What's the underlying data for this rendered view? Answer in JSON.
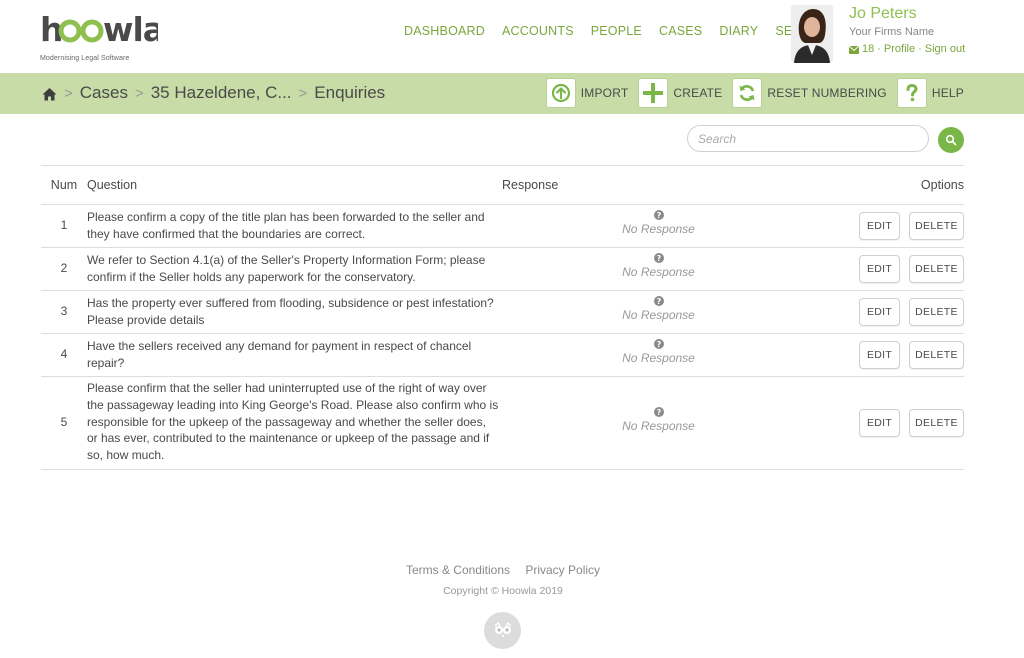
{
  "brand": {
    "name": "hoowla",
    "tagline": "Modernising Legal Software",
    "color": "#8fbf4e"
  },
  "nav": [
    "DASHBOARD",
    "ACCOUNTS",
    "PEOPLE",
    "CASES",
    "DIARY",
    "SETUP"
  ],
  "user": {
    "name": "Jo Peters",
    "firm": "Your Firms Name",
    "message_count": "18",
    "profile_label": "Profile",
    "sign_out_label": "Sign out",
    "separator": "·"
  },
  "breadcrumb": {
    "items": [
      "Cases",
      "35 Hazeldene, C...",
      "Enquiries"
    ],
    "separator": ">"
  },
  "actions": {
    "import": "IMPORT",
    "create": "CREATE",
    "reset": "RESET NUMBERING",
    "help": "HELP"
  },
  "search": {
    "placeholder": "Search"
  },
  "table": {
    "headers": {
      "num": "Num",
      "question": "Question",
      "response": "Response",
      "options": "Options"
    },
    "edit_label": "EDIT",
    "delete_label": "DELETE",
    "rows": [
      {
        "num": "1",
        "question": "Please confirm a copy of the title plan has been forwarded to the seller and they have confirmed that the boundaries are correct.",
        "response": "No Response"
      },
      {
        "num": "2",
        "question": "We refer to Section 4.1(a) of the Seller's Property Information Form; please confirm if the Seller holds any paperwork for the conservatory.",
        "response": "No Response"
      },
      {
        "num": "3",
        "question": "Has the property ever suffered from flooding, subsidence or pest infestation? Please provide details",
        "response": "No Response"
      },
      {
        "num": "4",
        "question": "Have the sellers received any demand for payment in respect of chancel repair?",
        "response": "No Response"
      },
      {
        "num": "5",
        "question": "Please confirm that the seller had uninterrupted use of the right of way over the passageway leading into King George's Road. Please also confirm who is responsible for the upkeep of the passageway and whether the seller does, or has ever, contributed to the maintenance or upkeep of the passage and if so, how much.",
        "response": "No Response"
      }
    ]
  },
  "footer": {
    "terms": "Terms & Conditions",
    "privacy": "Privacy Policy",
    "copyright": "Copyright © Hoowla 2019"
  }
}
